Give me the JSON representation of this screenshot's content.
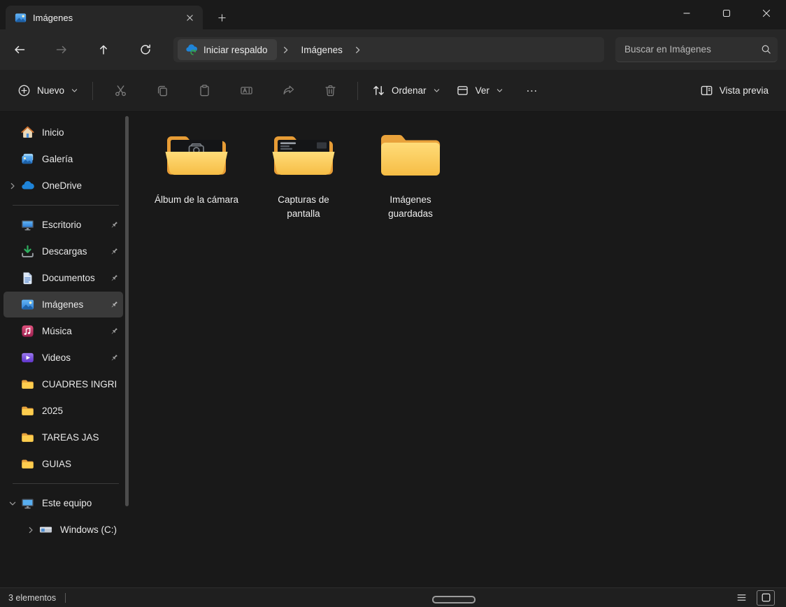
{
  "window": {
    "tab_title": "Imágenes"
  },
  "navbar": {
    "backup_button": "Iniciar respaldo",
    "breadcrumb_current": "Imágenes",
    "search_placeholder": "Buscar en Imágenes"
  },
  "toolbar": {
    "new_label": "Nuevo",
    "sort_label": "Ordenar",
    "view_label": "Ver",
    "more_label": "…",
    "preview_label": "Vista previa"
  },
  "sidebar": {
    "items": [
      {
        "label": "Inicio",
        "icon": "home"
      },
      {
        "label": "Galería",
        "icon": "gallery"
      },
      {
        "label": "OneDrive",
        "icon": "onedrive-cloud",
        "expander": "collapsed"
      },
      {
        "label": "Escritorio",
        "icon": "desktop",
        "pinned": true
      },
      {
        "label": "Descargas",
        "icon": "downloads",
        "pinned": true
      },
      {
        "label": "Documentos",
        "icon": "documents",
        "pinned": true
      },
      {
        "label": "Imágenes",
        "icon": "pictures",
        "pinned": true,
        "selected": true
      },
      {
        "label": "Música",
        "icon": "music",
        "pinned": true
      },
      {
        "label": "Videos",
        "icon": "videos",
        "pinned": true
      },
      {
        "label": "CUADRES INGRI",
        "icon": "folder"
      },
      {
        "label": "2025",
        "icon": "folder"
      },
      {
        "label": "TAREAS JAS",
        "icon": "folder"
      },
      {
        "label": "GUIAS",
        "icon": "folder"
      },
      {
        "label": "Este equipo",
        "icon": "this-pc",
        "expander": "expanded"
      },
      {
        "label": "Windows (C:)",
        "icon": "windows-drive",
        "expander": "collapsed",
        "indent": true
      }
    ]
  },
  "content": {
    "folders": [
      {
        "name": "Álbum de la cámara",
        "thumbnail": "camera"
      },
      {
        "name": "Capturas de pantalla",
        "thumbnail": "screenshot"
      },
      {
        "name": "Imágenes guardadas",
        "thumbnail": "plain"
      }
    ]
  },
  "statusbar": {
    "count": "3 elementos"
  },
  "colors": {
    "folder_yellow": "#fdc84d",
    "onedrive_blue": "#1f84d8",
    "selection_gray": "#3a3a3a",
    "background_dark": "#191919"
  }
}
